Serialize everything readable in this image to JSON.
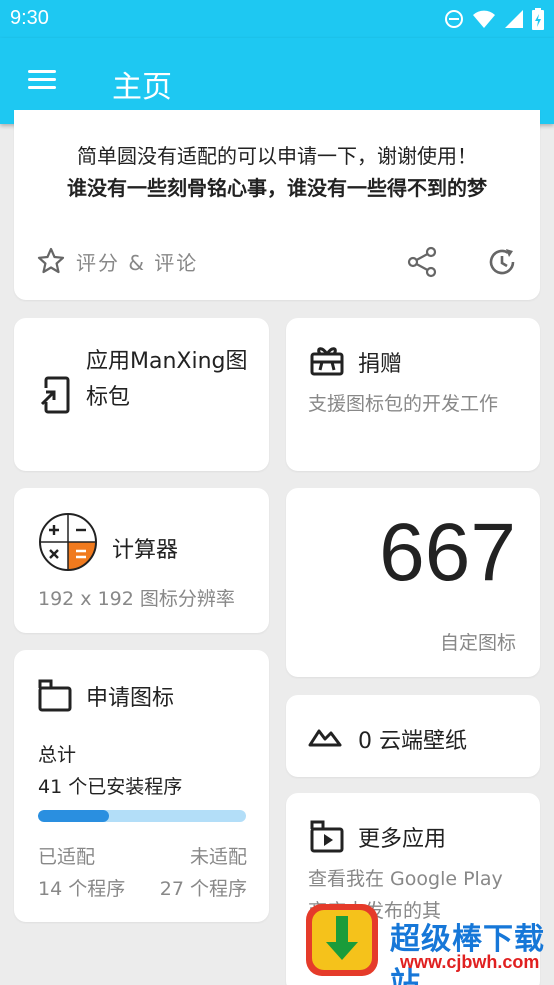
{
  "status_bar": {
    "time": "9:30",
    "icons": [
      "dnd-icon",
      "wifi-icon",
      "signal-icon",
      "battery-icon"
    ]
  },
  "app_bar": {
    "title": "主页",
    "color": "#1ec8f2"
  },
  "header_card": {
    "line1": "简单圆没有适配的可以申请一下，谢谢使用！",
    "line2": "谁没有一些刻骨铭心事，谁没有一些得不到的梦",
    "rate_label": "评分 & 评论"
  },
  "apply_card": {
    "label": "应用ManXing图标包"
  },
  "donate_card": {
    "title": "捐赠",
    "description": "支援图标包的开发工作"
  },
  "calculator_card": {
    "title": "计算器",
    "description": "192 x 192 图标分辨率"
  },
  "icon_count_card": {
    "count": "667",
    "label": "自定图标"
  },
  "request_card": {
    "title": "申请图标",
    "total_label": "总计",
    "total_value": "41 个已安装程序",
    "adapted_label": "已适配",
    "adapted_value": "14 个程序",
    "unadapted_label": "未适配",
    "unadapted_value": "27 个程序",
    "progress_fraction": 0.34
  },
  "wallpaper_card": {
    "title": "0 云端壁纸"
  },
  "more_apps_card": {
    "title": "更多应用",
    "description": "查看我在 Google Play 商店中发布的其"
  },
  "watermark": {
    "text_cn": "超级棒下载站",
    "text_url": "www.cjbwh.com"
  },
  "colors": {
    "accent": "#1ec8f2",
    "progress_fill": "#2a8fe0",
    "progress_track": "#b3def8",
    "calc_orange": "#f07a1e"
  }
}
